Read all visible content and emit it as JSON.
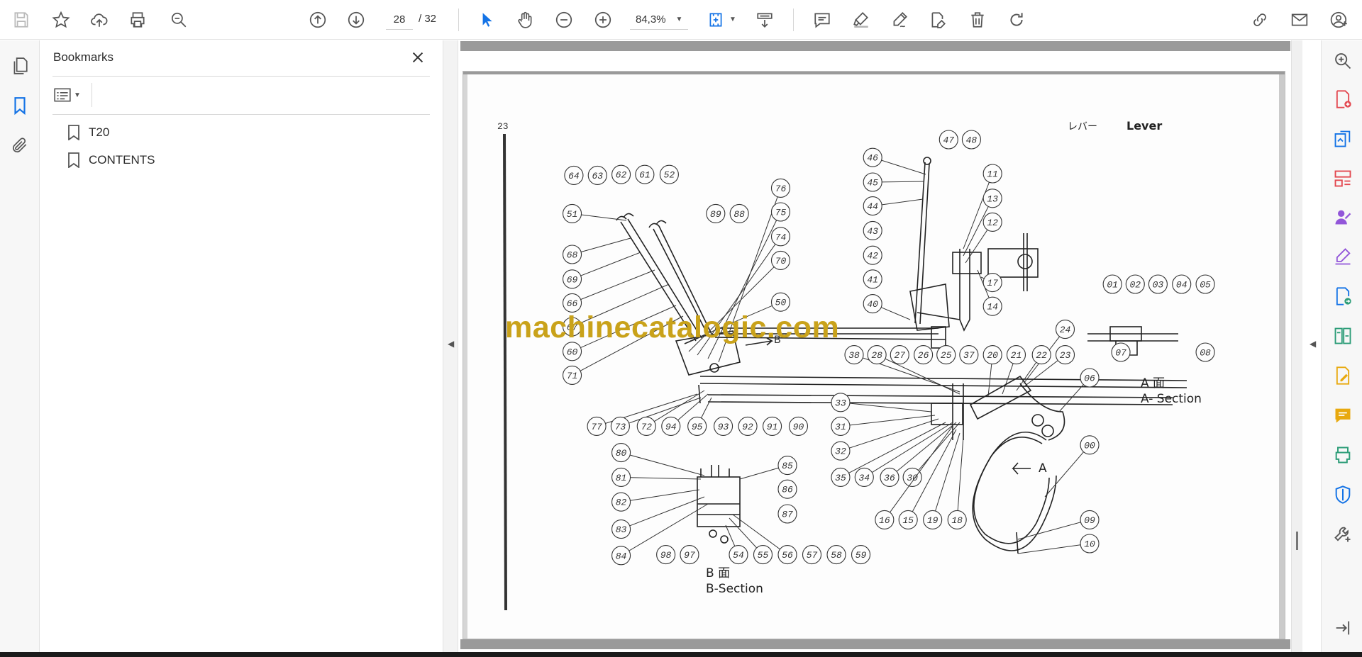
{
  "toolbar": {
    "page_current": "28",
    "page_total": "/ 32",
    "zoom": "84,3%",
    "icons": [
      "save-icon",
      "star-icon",
      "cloud-upload-icon",
      "print-icon",
      "find-icon",
      "page-up-icon",
      "page-down-icon",
      "pointer-icon",
      "hand-icon",
      "zoom-out-icon",
      "zoom-in-icon",
      "fit-page-icon",
      "scroll-mode-icon",
      "comment-icon",
      "highlight-icon",
      "draw-icon",
      "edit-stamp-icon",
      "delete-icon",
      "rotate-icon",
      "share-link-icon",
      "email-icon",
      "account-icon"
    ]
  },
  "bookmarks": {
    "title": "Bookmarks",
    "items": [
      {
        "label": "T20"
      },
      {
        "label": "CONTENTS"
      }
    ]
  },
  "document": {
    "page_number": "23",
    "header_jp": "レバー",
    "header_en": "Lever",
    "watermark": "machinecatalogic.com",
    "section_a_jp": "A 面",
    "section_a_en": "A- Section",
    "section_b_jp": "B 面",
    "section_b_en": "B-Section",
    "arrow_a": "A",
    "arrow_b": "B",
    "callouts": [
      "64",
      "63",
      "62",
      "61",
      "52",
      "51",
      "68",
      "69",
      "66",
      "67",
      "60",
      "71",
      "89",
      "88",
      "76",
      "75",
      "74",
      "70",
      "50",
      "46",
      "45",
      "44",
      "43",
      "42",
      "41",
      "40",
      "47",
      "48",
      "11",
      "13",
      "12",
      "17",
      "14",
      "01",
      "02",
      "03",
      "04",
      "05",
      "07",
      "08",
      "24",
      "06",
      "00",
      "09",
      "10",
      "38",
      "28",
      "27",
      "26",
      "25",
      "37",
      "20",
      "21",
      "22",
      "23",
      "33",
      "31",
      "32",
      "35",
      "34",
      "36",
      "30",
      "16",
      "15",
      "19",
      "18",
      "77",
      "73",
      "72",
      "94",
      "95",
      "93",
      "92",
      "91",
      "90",
      "80",
      "81",
      "82",
      "83",
      "84",
      "85",
      "86",
      "87",
      "98",
      "97",
      "54",
      "55",
      "56",
      "57",
      "58",
      "59"
    ]
  },
  "right_rail": {
    "tools": [
      "zoom-search-icon",
      "create-pdf-icon",
      "export-pdf-icon",
      "organize-pages-icon",
      "request-signature-icon",
      "fill-sign-icon",
      "send-track-icon",
      "compare-icon",
      "edit-pdf-icon",
      "comment-tool-icon",
      "print-production-icon",
      "protect-icon",
      "more-tools-icon",
      "collapse-rail-icon"
    ]
  },
  "colors": {
    "accent_blue": "#1473e6",
    "icon_gray": "#6e6e6e",
    "red_tool": "#e34850",
    "purple_tool": "#9256d9",
    "green_tool": "#2d9d78",
    "yellow_tool": "#e8a90e",
    "watermark": "#c9a21a"
  }
}
